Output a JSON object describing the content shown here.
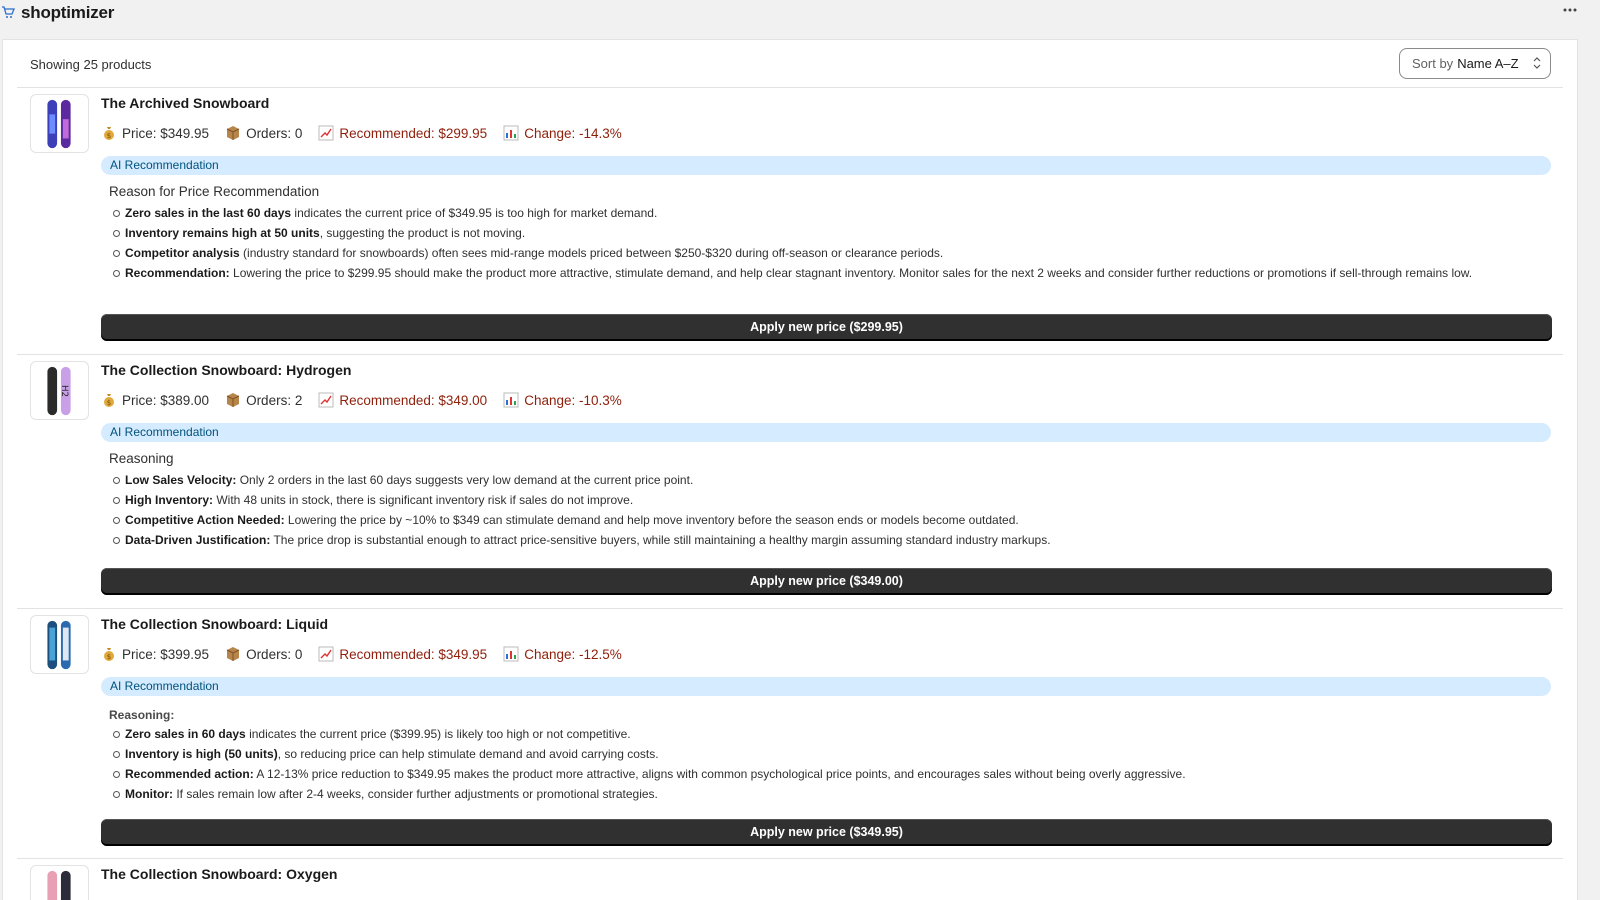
{
  "app": {
    "title": "shoptimizer",
    "menu_icon": "more-horizontal-icon"
  },
  "list_header": {
    "count_text": "Showing 25 products",
    "sort_prefix": "Sort by",
    "sort_value": "Name A–Z"
  },
  "products": [
    {
      "title": "The Archived Snowboard",
      "price": "Price: $349.95",
      "orders": "Orders: 0",
      "recommended": "Recommended: $299.95",
      "change": "Change: -14.3%",
      "ai_label": "AI Recommendation",
      "reason_heading": "Reason for Price Recommendation",
      "reasons": [
        {
          "bold": "Zero sales in the last 60 days",
          "text": " indicates the current price of $349.95 is too high for market demand."
        },
        {
          "bold": "Inventory remains high at 50 units",
          "text": ", suggesting the product is not moving."
        },
        {
          "bold": "Competitor analysis",
          "text": " (industry standard for snowboards) often sees mid-range models priced between $250-$320 during off-season or clearance periods."
        },
        {
          "bold": "Recommendation:",
          "text": " Lowering the price to $299.95 should make the product more attractive, stimulate demand, and help clear stagnant inventory. Monitor sales for the next 2 weeks and consider further reductions or promotions if sell-through remains low."
        }
      ],
      "button": "Apply new price ($299.95)"
    },
    {
      "title": "The Collection Snowboard: Hydrogen",
      "price": "Price: $389.00",
      "orders": "Orders: 2",
      "recommended": "Recommended: $349.00",
      "change": "Change: -10.3%",
      "ai_label": "AI Recommendation",
      "reason_heading": "Reasoning",
      "reasons": [
        {
          "bold": "Low Sales Velocity:",
          "text": " Only 2 orders in the last 60 days suggests very low demand at the current price point."
        },
        {
          "bold": "High Inventory:",
          "text": " With 48 units in stock, there is significant inventory risk if sales do not improve."
        },
        {
          "bold": "Competitive Action Needed:",
          "text": " Lowering the price by ~10% to $349 can stimulate demand and help move inventory before the season ends or models become outdated."
        },
        {
          "bold": "Data-Driven Justification:",
          "text": " The price drop is substantial enough to attract price-sensitive buyers, while still maintaining a healthy margin assuming standard industry markups."
        }
      ],
      "button": "Apply new price ($349.00)"
    },
    {
      "title": "The Collection Snowboard: Liquid",
      "price": "Price: $399.95",
      "orders": "Orders: 0",
      "recommended": "Recommended: $349.95",
      "change": "Change: -12.5%",
      "ai_label": "AI Recommendation",
      "reason_heading": "Reasoning:",
      "reasons": [
        {
          "bold": "Zero sales in 60 days",
          "text": " indicates the current price ($399.95) is likely too high or not competitive."
        },
        {
          "bold": "Inventory is high (50 units)",
          "text": ", so reducing price can help stimulate demand and avoid carrying costs."
        },
        {
          "bold": "Recommended action:",
          "text": " A 12-13% price reduction to $349.95 makes the product more attractive, aligns with common psychological price points, and encourages sales without being overly aggressive."
        },
        {
          "bold": "Monitor:",
          "text": " If sales remain low after 2-4 weeks, consider further adjustments or promotional strategies."
        }
      ],
      "button": "Apply new price ($349.95)"
    },
    {
      "title": "The Collection Snowboard: Oxygen"
    }
  ],
  "icons": {
    "price": "money-bag-icon",
    "orders": "package-icon",
    "recommended": "chart-increasing-icon",
    "change": "bar-chart-icon"
  },
  "colors": {
    "accent_text": "#8e1f0b",
    "badge_bg": "#d5ebff",
    "button_bg": "#303030"
  }
}
